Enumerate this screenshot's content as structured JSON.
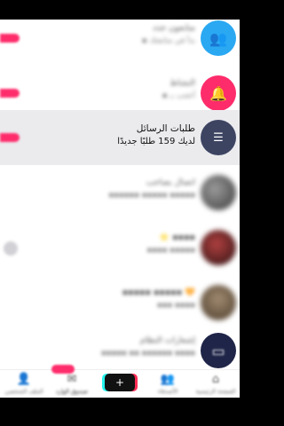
{
  "rows": [
    {
      "title": "متابعون جدد",
      "subtitle": "▪ بدأ في متابعتك",
      "avatar_color": "#2aa8f2",
      "avatar_icon": "people-icon",
      "avatar_glyph": "👥",
      "has_pill": true
    },
    {
      "title": "النشاط",
      "subtitle": "▪ أعجب بـ",
      "avatar_color": "#fe2c6b",
      "avatar_icon": "bell-icon",
      "avatar_glyph": "🔔",
      "has_pill": true
    },
    {
      "title": "طلبات الرسائل",
      "subtitle": "لديك 159 طلبًا جديدًا",
      "avatar_color": "#3d4462",
      "avatar_icon": "message-icon",
      "avatar_glyph": "☰",
      "has_pill": true,
      "highlighted": true
    },
    {
      "title": "اتصال بصاحب",
      "subtitle": "▪▪▪▪▪▪ ▪▪▪▪▪ ▪▪▪▪▪",
      "avatar_color": "#6a6a6a",
      "avatar_icon": "avatar",
      "avatar_glyph": "",
      "has_pill": false
    },
    {
      "title": "⭐ ▪▪▪▪",
      "subtitle": "▪▪▪▪ ▪▪▪▪▪",
      "avatar_color": "#5a2a2a",
      "avatar_icon": "avatar",
      "avatar_glyph": "",
      "has_pill": false,
      "has_left_dot": true
    },
    {
      "title": "▪▪▪▪▪ ▪▪▪▪▪ 🧡",
      "subtitle": "▪▪▪ ▪▪▪▪",
      "avatar_color": "#7a6a5a",
      "avatar_icon": "avatar",
      "avatar_glyph": "",
      "has_pill": false
    },
    {
      "title": "إشعارات النظام",
      "subtitle": "▪▪▪▪▪ ▪▪ ▪▪▪▪▪▪ ▪▪▪▪",
      "avatar_color": "#1f2548",
      "avatar_icon": "inbox-icon",
      "avatar_glyph": "▭",
      "has_pill": false
    }
  ],
  "nav": [
    {
      "label": "الصفحة الرئيسية",
      "icon": "home-icon",
      "glyph": "⌂"
    },
    {
      "label": "الأصدقاء",
      "icon": "friends-icon",
      "glyph": "👥"
    },
    {
      "label": "",
      "icon": "create-icon",
      "glyph": "+"
    },
    {
      "label": "صندوق الوارد",
      "icon": "inbox-icon",
      "glyph": "✉"
    },
    {
      "label": "الملف الشخصي",
      "icon": "profile-icon",
      "glyph": "👤"
    }
  ]
}
